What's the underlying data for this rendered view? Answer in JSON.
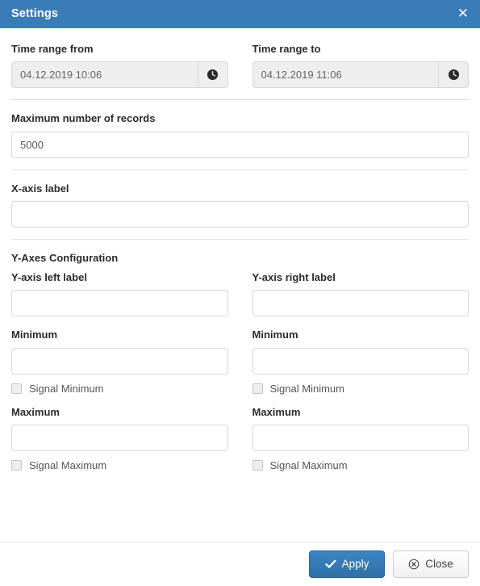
{
  "header": {
    "title": "Settings",
    "close_icon": "close-x-icon"
  },
  "time_range": {
    "from": {
      "label": "Time range from",
      "value": "04.12.2019 10:06",
      "placeholder": "",
      "button_icon": "clock-icon"
    },
    "to": {
      "label": "Time range to",
      "value": "04.12.2019 11:06",
      "placeholder": "",
      "button_icon": "clock-icon"
    }
  },
  "max_records": {
    "label": "Maximum number of records",
    "value": "5000",
    "placeholder": ""
  },
  "x_axis": {
    "label": "X-axis label",
    "value": "",
    "placeholder": ""
  },
  "y_axes": {
    "group_title": "Y-Axes Configuration",
    "left": {
      "label_title": "Y-axis left label",
      "label_value": "",
      "minimum_title": "Minimum",
      "minimum_value": "",
      "signal_minimum_label": "Signal Minimum",
      "signal_minimum_checked": false,
      "maximum_title": "Maximum",
      "maximum_value": "",
      "signal_maximum_label": "Signal Maximum",
      "signal_maximum_checked": false
    },
    "right": {
      "label_title": "Y-axis right label",
      "label_value": "",
      "minimum_title": "Minimum",
      "minimum_value": "",
      "signal_minimum_label": "Signal Minimum",
      "signal_minimum_checked": false,
      "maximum_title": "Maximum",
      "maximum_value": "",
      "signal_maximum_label": "Signal Maximum",
      "signal_maximum_checked": false
    }
  },
  "footer": {
    "apply_label": "Apply",
    "apply_icon": "check-icon",
    "close_label": "Close",
    "close_icon": "circle-x-icon"
  },
  "colors": {
    "header_blue": "#3a7cb8",
    "primary_button": "#2f6fa6",
    "divider": "#e2e2e2",
    "input_border": "#d8d8d8",
    "disabled_input_bg": "#eeeeee"
  }
}
